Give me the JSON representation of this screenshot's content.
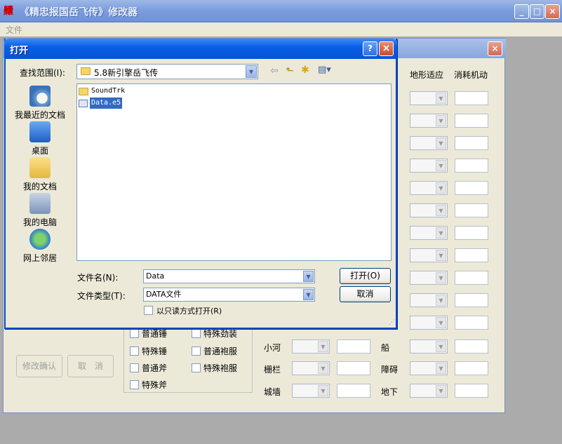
{
  "main": {
    "title": "《精忠报国岳飞传》修改器",
    "menu_file": "文件",
    "app_icon_glyph": "齉",
    "minimize": "_",
    "maximize": "□",
    "close": "×"
  },
  "editor": {
    "header_terrain": "地形适应",
    "header_mobility": "消耗机动",
    "terrain_labels_left": [
      "小河",
      "栅栏",
      "城墙"
    ],
    "terrain_labels_right": [
      "船",
      "障碍",
      "地下"
    ],
    "weapons": [
      "普通锤",
      "特殊劲装",
      "特殊锤",
      "普通袍服",
      "普通斧",
      "特殊袍服",
      "特殊斧"
    ],
    "btn_confirm": "修改确认",
    "btn_cancel": "取　消"
  },
  "open_dialog": {
    "title": "打开",
    "help": "?",
    "close": "×",
    "lookin_label": "查找范围(I):",
    "lookin_value": "5.8新引擎岳飞传",
    "places": [
      "我最近的文档",
      "桌面",
      "我的文档",
      "我的电脑",
      "网上邻居"
    ],
    "files": [
      {
        "name": "SoundTrk",
        "type": "folder",
        "selected": false
      },
      {
        "name": "Data.e5",
        "type": "file",
        "selected": true
      }
    ],
    "filename_label": "文件名(N):",
    "filename_value": "Data",
    "filetype_label": "文件类型(T):",
    "filetype_value": "DATA文件",
    "readonly_label": "以只读方式打开(R)",
    "open_button": "打开(O)",
    "cancel_button": "取消"
  }
}
